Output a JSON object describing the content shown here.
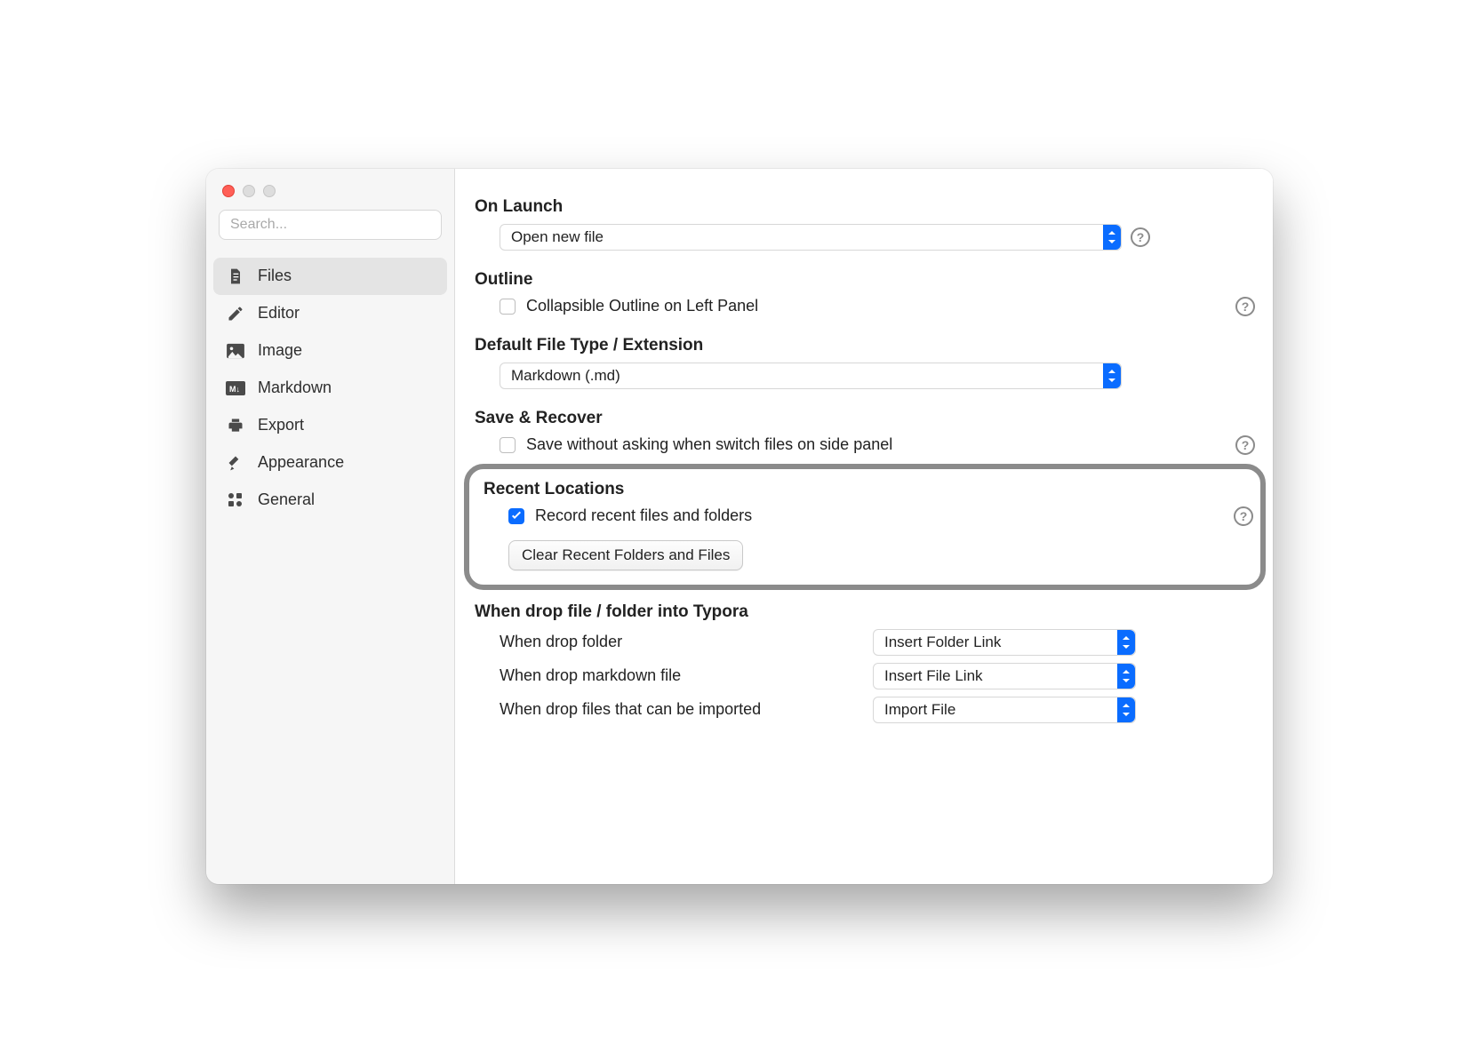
{
  "search": {
    "placeholder": "Search..."
  },
  "sidebar": {
    "items": [
      {
        "label": "Files"
      },
      {
        "label": "Editor"
      },
      {
        "label": "Image"
      },
      {
        "label": "Markdown"
      },
      {
        "label": "Export"
      },
      {
        "label": "Appearance"
      },
      {
        "label": "General"
      }
    ]
  },
  "sections": {
    "onLaunch": {
      "title": "On Launch",
      "value": "Open new file"
    },
    "outline": {
      "title": "Outline",
      "checkbox_label": "Collapsible Outline on Left Panel",
      "checked": false
    },
    "defaultExt": {
      "title": "Default File Type / Extension",
      "value": "Markdown (.md)"
    },
    "saveRecover": {
      "title": "Save & Recover",
      "checkbox_label": "Save without asking when switch files on side panel",
      "checked": false
    },
    "recent": {
      "title": "Recent Locations",
      "checkbox_label": "Record recent files and folders",
      "checked": true,
      "clear_button": "Clear Recent Folders and Files"
    },
    "drop": {
      "title": "When drop file / folder into Typora",
      "rows": [
        {
          "label": "When drop folder",
          "value": "Insert Folder Link"
        },
        {
          "label": "When drop markdown file",
          "value": "Insert File Link"
        },
        {
          "label": "When drop files that can be imported",
          "value": "Import File"
        }
      ]
    }
  }
}
